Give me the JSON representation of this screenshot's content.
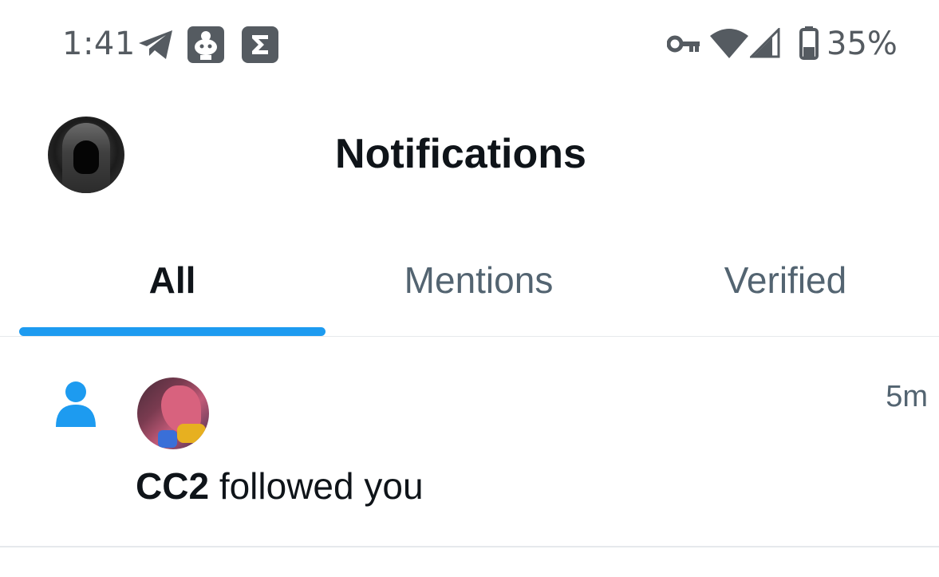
{
  "status_bar": {
    "time": "1:41",
    "battery_percent": "35%",
    "icons": [
      "telegram-icon",
      "reddit-icon",
      "sigma-icon",
      "vpn-key-icon",
      "wifi-icon",
      "cell-signal-icon",
      "battery-icon"
    ]
  },
  "header": {
    "title": "Notifications",
    "avatar": "profile-avatar"
  },
  "tabs": [
    {
      "label": "All",
      "active": true
    },
    {
      "label": "Mentions",
      "active": false
    },
    {
      "label": "Verified",
      "active": false
    }
  ],
  "notifications": [
    {
      "type": "follow",
      "icon": "person-icon",
      "user": "CC2",
      "action": "followed you",
      "time_ago": "5m"
    }
  ],
  "colors": {
    "accent": "#1d9bf0",
    "text_primary": "#0f1419",
    "text_secondary": "#536471",
    "divider": "#e6e9ec"
  }
}
